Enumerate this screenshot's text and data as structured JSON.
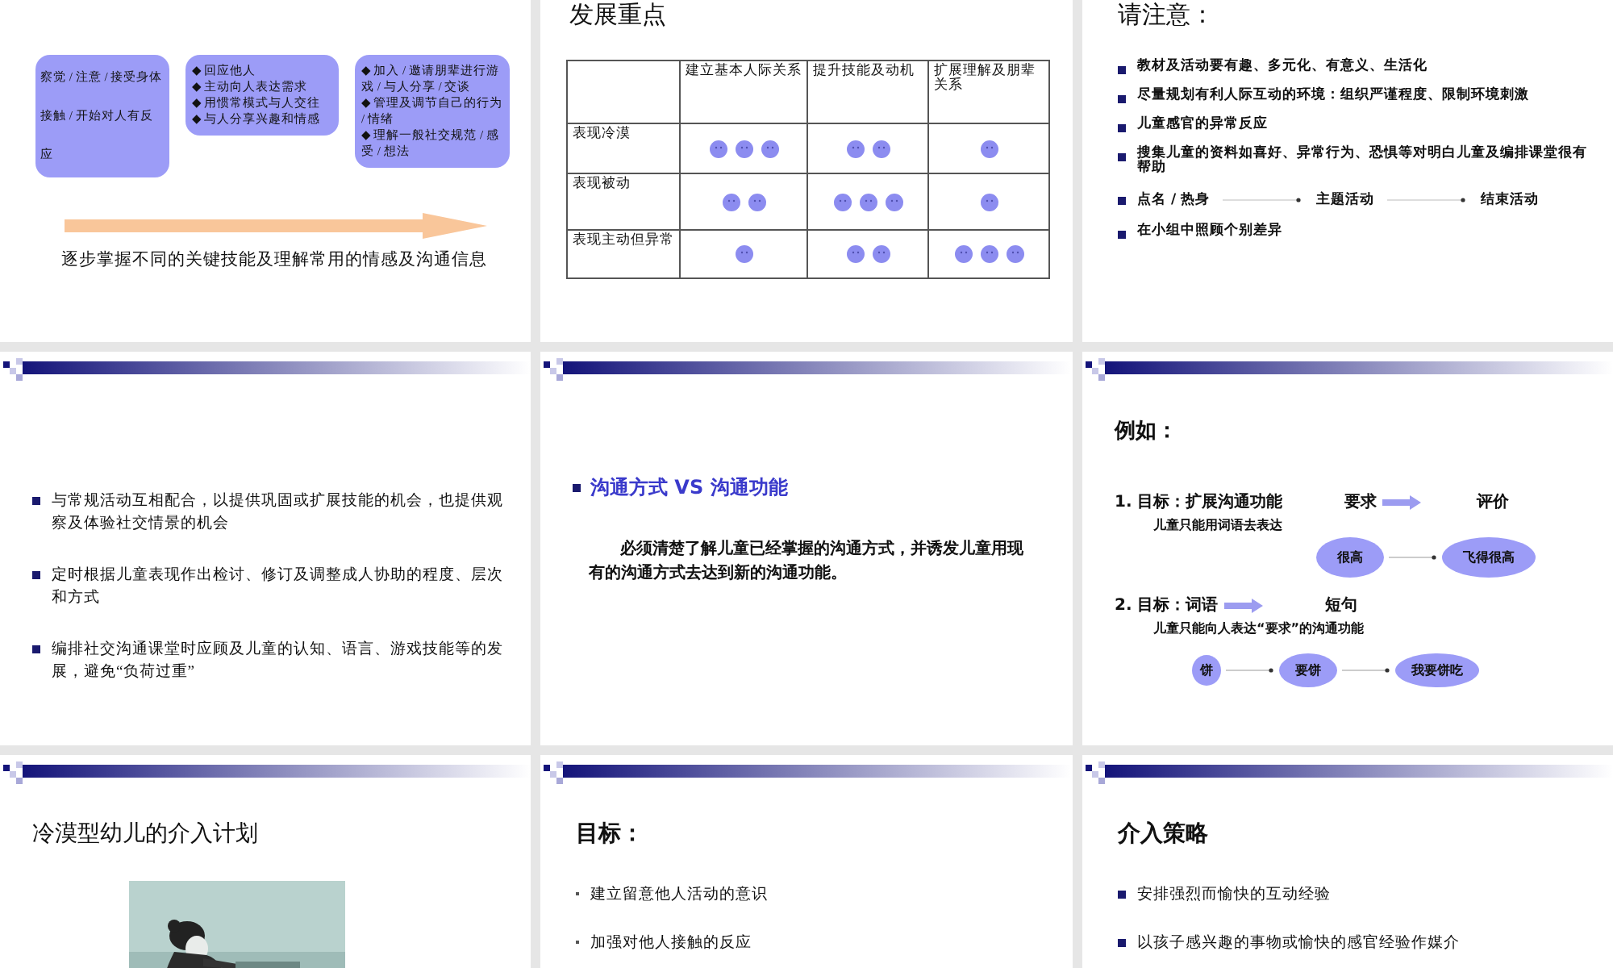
{
  "slides": [
    {
      "kind": "stages",
      "header": false,
      "boxes": [
        {
          "lines": [
            "察觉 / 注意 / 接受身体",
            "接触 / 开始对人有反应"
          ]
        },
        {
          "lines": [
            "◆ 回应他人",
            "◆ 主动向人表达需求",
            "◆ 用惯常模式与人交往",
            "◆ 与人分享兴趣和情感"
          ]
        },
        {
          "lines": [
            "◆ 加入 / 邀请朋辈进行游戏 / 与人分享 / 交谈",
            "◆ 管理及调节自己的行为 / 情绪",
            "◆ 理解一般社交规范 / 感受 / 想法"
          ]
        }
      ],
      "caption": "逐步掌握不同的关键技能及理解常用的情感及沟通信息"
    },
    {
      "kind": "table",
      "header": false,
      "title": "发展重点",
      "columns": [
        "建立基本人际关系",
        "提升技能及动机",
        "扩展理解及朋辈关系"
      ],
      "rows": [
        {
          "label": "表现冷漠",
          "cells": [
            {
              "faces": [
                {
                  "kind": "smiley"
                },
                {
                  "kind": "smiley"
                },
                {
                  "kind": "smiley"
                }
              ]
            },
            {
              "faces": [
                {
                  "kind": "smiley"
                },
                {
                  "kind": "smiley"
                }
              ]
            },
            {
              "faces": [
                {
                  "kind": "smiley"
                }
              ]
            }
          ]
        },
        {
          "label": "表现被动",
          "cells": [
            {
              "faces": [
                {
                  "kind": "smiley"
                },
                {
                  "kind": "smiley"
                }
              ]
            },
            {
              "faces": [
                {
                  "kind": "smiley"
                },
                {
                  "kind": "smiley"
                },
                {
                  "kind": "smiley"
                }
              ]
            },
            {
              "faces": [
                {
                  "kind": "smiley"
                }
              ]
            }
          ]
        },
        {
          "label": "表现主动但异常",
          "cells": [
            {
              "faces": [
                {
                  "kind": "smiley"
                }
              ]
            },
            {
              "faces": [
                {
                  "kind": "smiley"
                },
                {
                  "kind": "smiley"
                }
              ]
            },
            {
              "faces": [
                {
                  "kind": "smiley"
                },
                {
                  "kind": "smiley"
                },
                {
                  "kind": "smiley"
                }
              ]
            }
          ]
        }
      ]
    },
    {
      "kind": "bullets",
      "header": false,
      "title": "请注意：",
      "items": [
        {
          "text": "教材及活动要有趣、多元化、有意义、生活化"
        },
        {
          "text": "尽量规划有利人际互动的环境：组织严谨程度、限制环境刺激"
        },
        {
          "text": "儿童感官的异常反应"
        },
        {
          "text": "搜集儿童的资料如喜好、异常行为、恐惧等对明白儿童及编排课堂很有帮助"
        },
        {
          "steps": [
            "点名 / 热身",
            "主题活动",
            "结束活动"
          ]
        },
        {
          "text": "在小组中照顾个别差异"
        }
      ]
    },
    {
      "kind": "bullets",
      "header": true,
      "items": [
        {
          "text": "与常规活动互相配合，以提供巩固或扩展技能的机会，也提供观察及体验社交情景的机会"
        },
        {
          "text": "定时根据儿童表现作出检讨、修订及调整成人协助的程度、层次和方式"
        },
        {
          "text": "编排社交沟通课堂时应顾及儿童的认知、语言、游戏技能等的发展，避免“负荷过重”"
        }
      ]
    },
    {
      "kind": "statement",
      "header": true,
      "heading": "沟通方式 VS 沟通功能",
      "body": "必须清楚了解儿童已经掌握的沟通方式，并诱发儿童用现有的沟通方式去达到新的沟通功能。"
    },
    {
      "kind": "example",
      "header": true,
      "title": "例如：",
      "goals": [
        {
          "label": "1. 目标：扩展沟通功能",
          "from": "要求",
          "to": "评价",
          "note": "儿童只能用词语去表达",
          "chain": [
            "很高",
            "飞得很高"
          ]
        },
        {
          "label": "2. 目标：词语",
          "to": "短句",
          "note": "儿童只能向人表达“要求”的沟通功能",
          "chain": [
            "饼",
            "要饼",
            "我要饼吃"
          ]
        }
      ]
    },
    {
      "kind": "picture_title",
      "header": true,
      "title": "冷漠型幼儿的介入计划"
    },
    {
      "kind": "dot_bullets",
      "header": true,
      "title": "目标：",
      "items": [
        {
          "text": "建立留意他人活动的意识"
        },
        {
          "text": "加强对他人接触的反应"
        }
      ]
    },
    {
      "kind": "bullets",
      "header": true,
      "title": "介入策略",
      "items": [
        {
          "text": "安排强烈而愉快的互动经验"
        },
        {
          "text": "以孩子感兴趣的事物或愉快的感官经验作媒介"
        }
      ]
    }
  ]
}
